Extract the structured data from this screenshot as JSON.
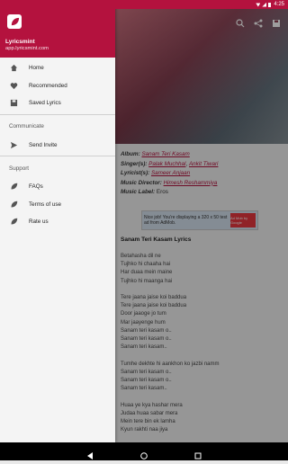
{
  "status_bar": {
    "time": "4:25"
  },
  "drawer": {
    "app_name": "Lyricsmint",
    "app_url": "app.lyricsmint.com",
    "items": [
      {
        "label": "Home",
        "icon": "home-icon"
      },
      {
        "label": "Recommended",
        "icon": "heart-icon"
      },
      {
        "label": "Saved Lyrics",
        "icon": "save-icon"
      }
    ],
    "section_communicate": "Communicate",
    "communicate_items": [
      {
        "label": "Send Invite",
        "icon": "send-icon"
      }
    ],
    "section_support": "Support",
    "support_items": [
      {
        "label": "FAQs",
        "icon": "leaf-icon"
      },
      {
        "label": "Terms of use",
        "icon": "leaf-icon"
      },
      {
        "label": "Rate us",
        "icon": "leaf-icon"
      }
    ]
  },
  "details": {
    "album_label": "Album:",
    "album": "Sanam Teri Kasam",
    "singers_label": "Singer(s):",
    "singer1": "Palak Muchhal",
    "singer2": "Ankit Tiwari",
    "lyricists_label": "Lyricist(s):",
    "lyricist": "Sameer Anjaan",
    "music_director_label": "Music Director:",
    "music_director": "Himesh Reshammiya",
    "music_label_label": "Music Label:",
    "music_label": "Eros"
  },
  "ad": {
    "text": "Nice job! You're displaying a 320 x 50 test ad from AdMob.",
    "logo": "Ad Mob by Google"
  },
  "lyrics": {
    "title": "Sanam Teri Kasam Lyrics",
    "text": "Betahasha dil ne\nTujhko hi chaaha hai\nHar duaa mein maine\nTujhko hi maanga hai\n\nTere jaana jaise koi baddua\nTere jaana jaise koi baddua\nDoor jaaoge jo tum\nMar jaayenge hum\nSanam teri kasam o..\nSanam teri kasam o..\nSanam teri kasam..\n\nTumhe dekhte hi aankhon ko jazbi namm\nSanam teri kasam o..\nSanam teri kasam o..\nSanam teri kasam..\n\nHuaa ye kya hashar mera\nJudaa huaa sabar mera\nMein tere bin ek lamha\nKyun rakhti naa jiya\n\nRaat bhar ashqo ne tujhko pukara hai"
  }
}
